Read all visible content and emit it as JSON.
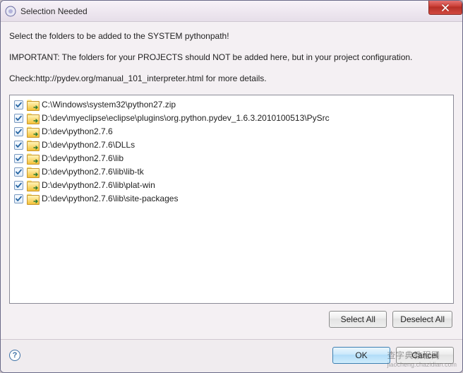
{
  "window": {
    "title": "Selection Needed"
  },
  "instructions": {
    "line1": "Select the folders to be added to the SYSTEM pythonpath!",
    "line2": "IMPORTANT: The folders for your PROJECTS should NOT be added here, but in your project configuration.",
    "line3": "Check:http://pydev.org/manual_101_interpreter.html for more details."
  },
  "items": [
    {
      "checked": true,
      "path": "C:\\Windows\\system32\\python27.zip"
    },
    {
      "checked": true,
      "path": "D:\\dev\\myeclipse\\eclipse\\plugins\\org.python.pydev_1.6.3.2010100513\\PySrc"
    },
    {
      "checked": true,
      "path": "D:\\dev\\python2.7.6"
    },
    {
      "checked": true,
      "path": "D:\\dev\\python2.7.6\\DLLs"
    },
    {
      "checked": true,
      "path": "D:\\dev\\python2.7.6\\lib"
    },
    {
      "checked": true,
      "path": "D:\\dev\\python2.7.6\\lib\\lib-tk"
    },
    {
      "checked": true,
      "path": "D:\\dev\\python2.7.6\\lib\\plat-win"
    },
    {
      "checked": true,
      "path": "D:\\dev\\python2.7.6\\lib\\site-packages"
    }
  ],
  "buttons": {
    "selectAll": "Select All",
    "deselectAll": "Deselect All",
    "ok": "OK",
    "cancel": "Cancel"
  },
  "help": {
    "glyph": "?"
  },
  "watermark": {
    "main": "查字典教程网",
    "sub": "jiaocheng.chazidian.com"
  }
}
